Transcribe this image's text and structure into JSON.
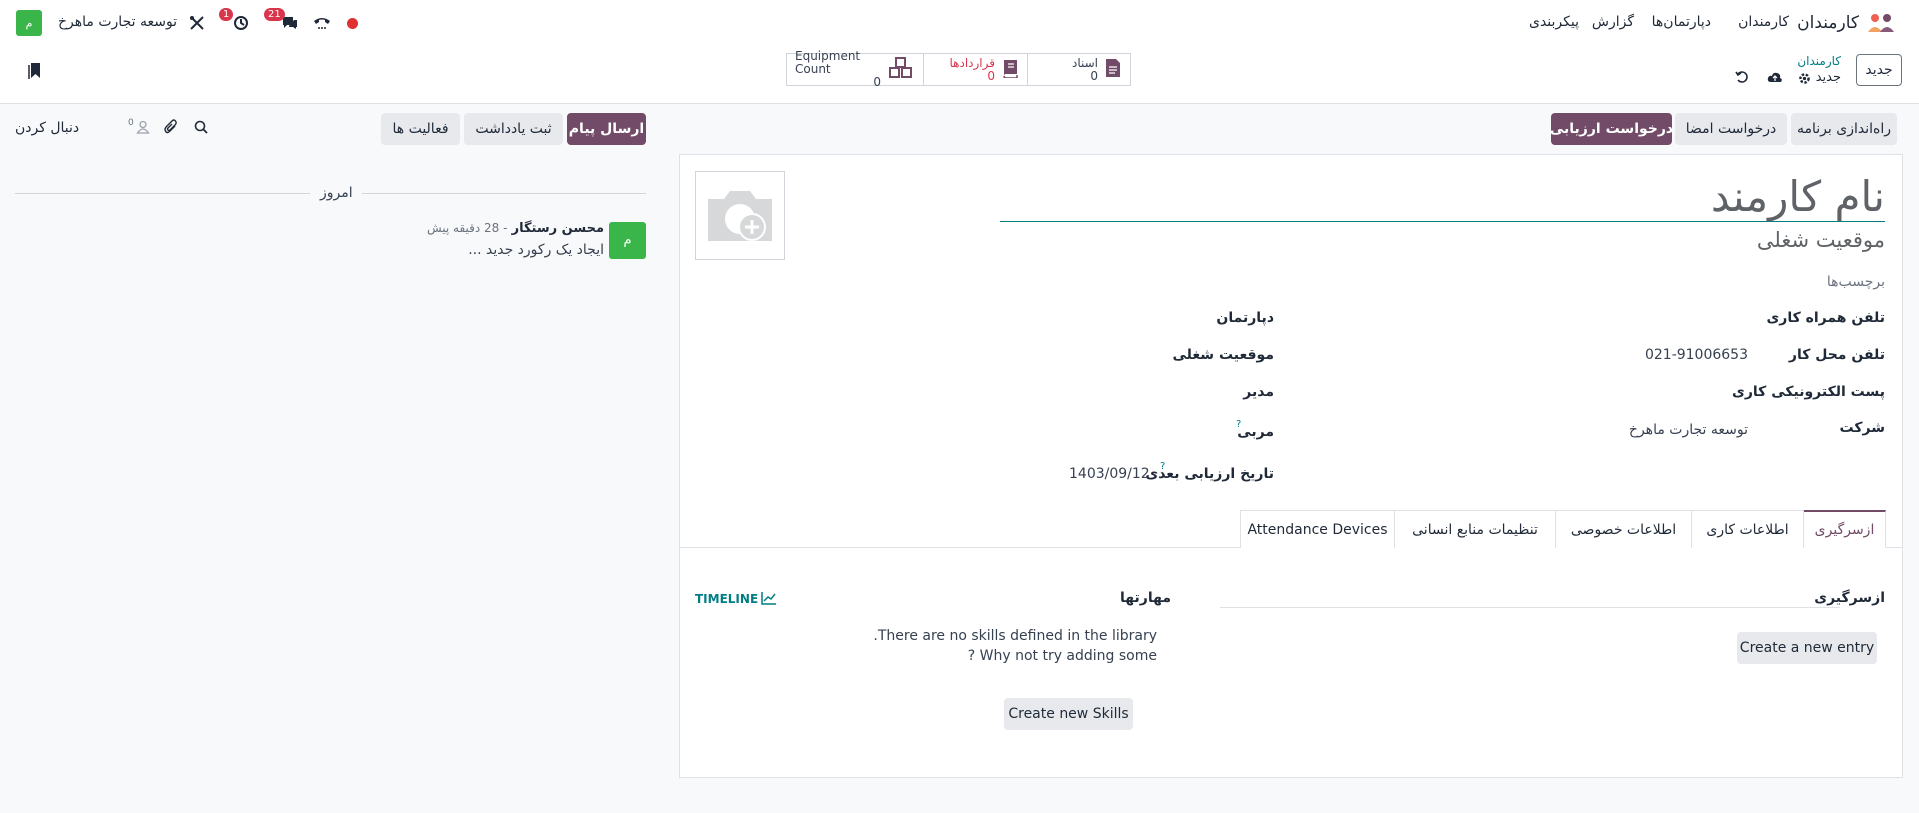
{
  "navbar": {
    "app_name": "کارمندان",
    "menu": [
      "کارمندان",
      "دپارتمان‌ها",
      "گزارش",
      "پیکربندی"
    ],
    "company_name": "توسعه تجارت ماهرخ",
    "company_avatar_letter": "م",
    "messages_count": "21",
    "activities_count": "1"
  },
  "control_panel": {
    "new_button": "جدید",
    "breadcrumb_parent": "کارمندان",
    "breadcrumb_current": "جدید",
    "stats": [
      {
        "label": "اسناد",
        "value": "0"
      },
      {
        "label": "قراردادها",
        "value": "0"
      },
      {
        "label": "Equipment Count",
        "value": "0"
      }
    ]
  },
  "form": {
    "header_buttons": {
      "launch_plan": "راه‌اندازی برنامه",
      "request_signature": "درخواست امضا",
      "request_appraisal": "درخواست ارزیابی"
    },
    "employee_name_placeholder": "نام کارمند",
    "job_position_placeholder": "موقعیت شغلی",
    "tags_placeholder": "برچسب‌ها",
    "fields": {
      "work_mobile": "تلفن همراه کاری",
      "work_phone": "تلفن محل کار",
      "work_phone_value": "021-91006653",
      "work_email": "پست الکترونیکی کاری",
      "company": "شرکت",
      "company_value": "توسعه تجارت ماهرخ",
      "department": "دپارتمان",
      "job_position": "موقعیت شغلی",
      "manager": "مدیر",
      "coach": "مربی",
      "next_appraisal": "تاریخ ارزیابی بعدی",
      "next_appraisal_value": "1403/09/12"
    },
    "tabs": [
      "ازسرگیری",
      "اطلاعات کاری",
      "اطلاعات خصوصی",
      "تنظیمات منابع انسانی",
      "Attendance Devices"
    ],
    "resume": {
      "title": "ازسرگیری",
      "create_entry": "Create a new entry"
    },
    "skills": {
      "title": "مهارتها",
      "timeline": "TIMELINE",
      "empty_line1": "There are no skills defined in the library.",
      "empty_line2": "Why not try adding some ?",
      "create_button": "Create new Skills"
    }
  },
  "chatter": {
    "send_message": "ارسال پیام",
    "log_note": "ثبت یادداشت",
    "activities": "فعالیت ها",
    "followers_count": "0",
    "follow": "دنبال کردن",
    "today": "امروز",
    "message": {
      "author": "محسن رستگار",
      "time": "- 28 دقیقه پیش",
      "body": "ایجاد یک رکورد جدید ...",
      "avatar_letter": "م"
    }
  },
  "colors": {
    "primary": "#714b67",
    "accent": "#017e84",
    "danger": "#d9364c",
    "avatar_green": "#39b54a"
  }
}
